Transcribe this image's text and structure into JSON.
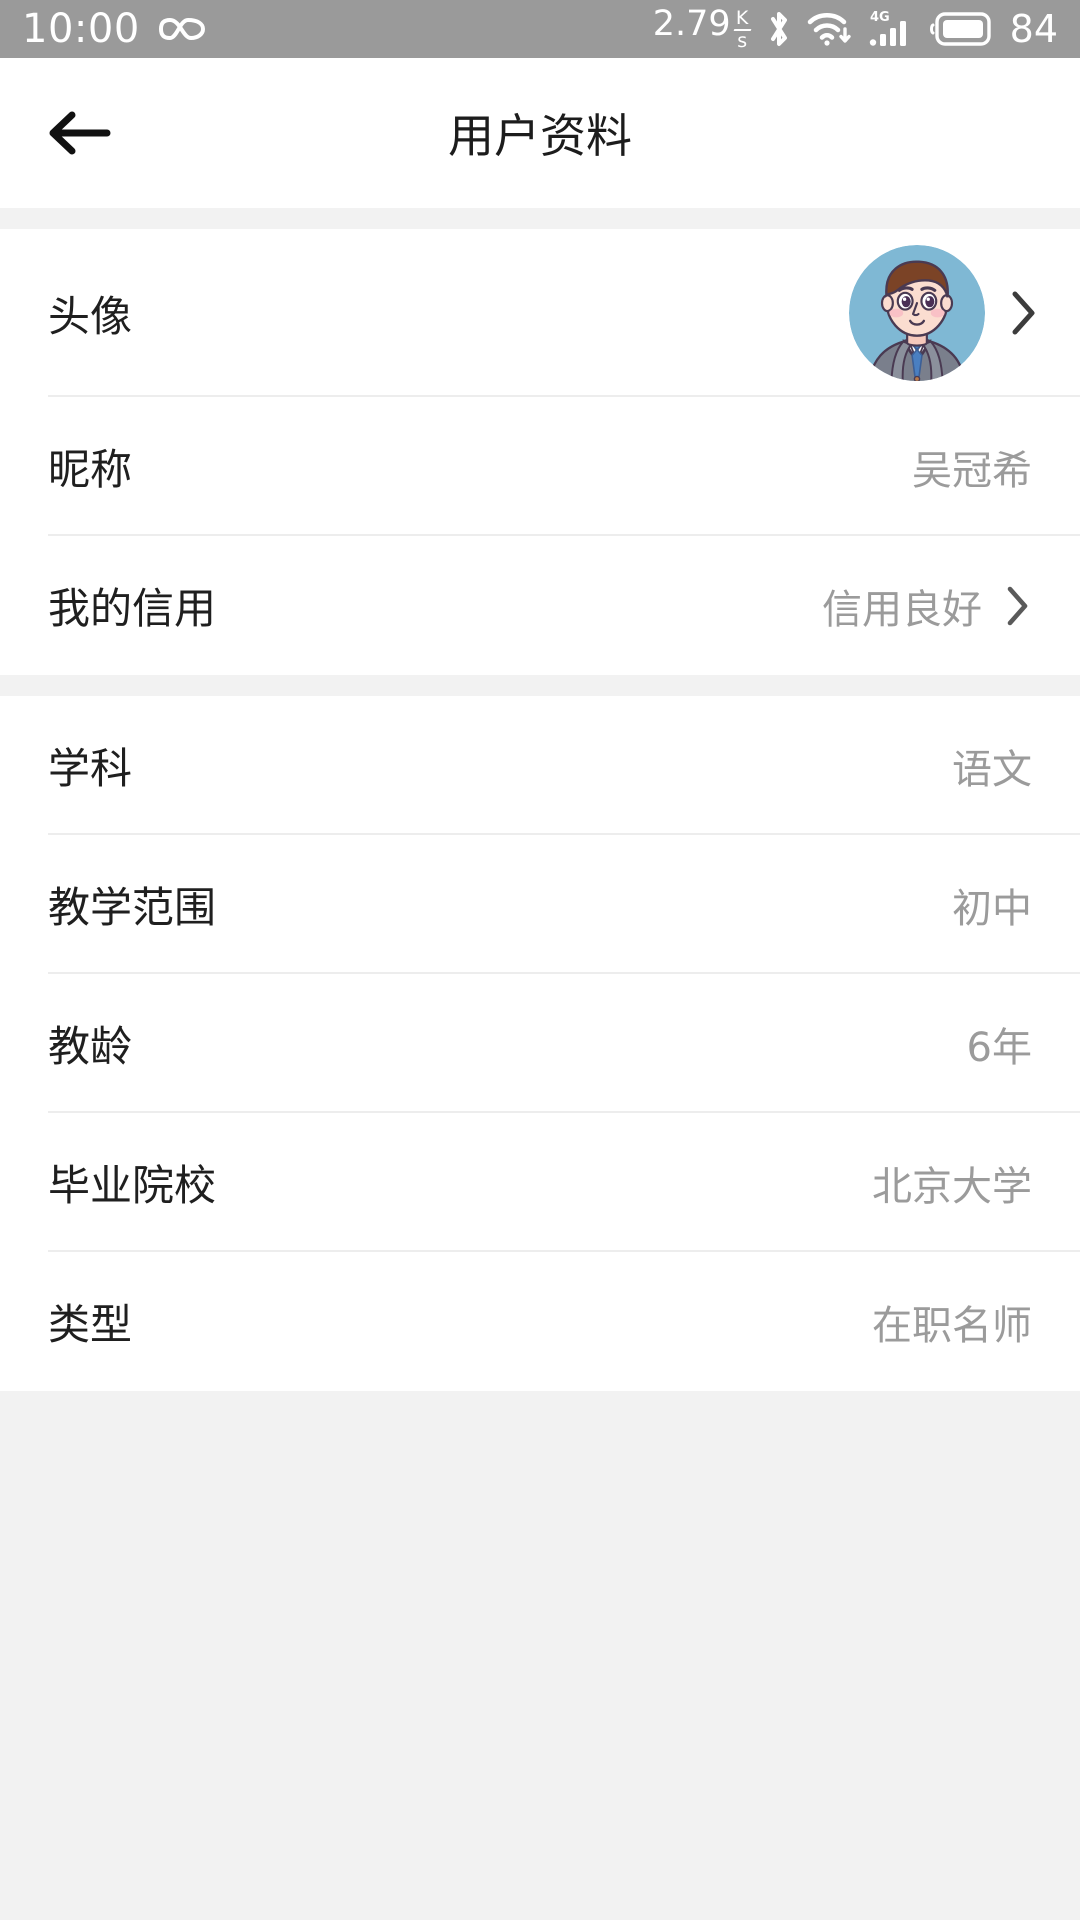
{
  "status_bar": {
    "time": "10:00",
    "infinity_icon": "infinity-icon",
    "network_speed": "2.79",
    "speed_unit_top": "K",
    "speed_unit_bottom": "s",
    "bluetooth_icon": "bluetooth-icon",
    "wifi_icon": "wifi-download-icon",
    "signal_label": "4G",
    "signal_icon": "cellular-signal-icon",
    "battery_icon": "battery-icon",
    "battery_level": "84"
  },
  "header": {
    "title": "用户资料",
    "back_icon": "arrow-left-icon"
  },
  "sections": [
    {
      "rows": [
        {
          "label": "头像",
          "value": "",
          "type": "avatar",
          "chevron": true
        },
        {
          "label": "昵称",
          "value": "吴冠希",
          "type": "text",
          "chevron": false
        },
        {
          "label": "我的信用",
          "value": "信用良好",
          "type": "text",
          "chevron": true
        }
      ]
    },
    {
      "rows": [
        {
          "label": "学科",
          "value": "语文",
          "type": "text",
          "chevron": false
        },
        {
          "label": "教学范围",
          "value": "初中",
          "type": "text",
          "chevron": false
        },
        {
          "label": "教龄",
          "value": "6年",
          "type": "text",
          "chevron": false
        },
        {
          "label": "毕业院校",
          "value": "北京大学",
          "type": "text",
          "chevron": false
        },
        {
          "label": "类型",
          "value": "在职名师",
          "type": "text",
          "chevron": false
        }
      ]
    }
  ],
  "avatar": {
    "name": "user-avatar",
    "background_color": "#7fb8d4",
    "hair_color": "#7b4326",
    "skin_color": "#fbddd0",
    "suit_color": "#7a7f8c",
    "tie_color": "#4a7fc1",
    "shirt_color": "#ffffff"
  },
  "colors": {
    "status_bar_bg": "#9a9a9a",
    "page_bg": "#f2f2f2",
    "card_bg": "#ffffff",
    "label_text": "#1f1f1f",
    "value_text": "#9b9b9b",
    "divider": "#ededed",
    "chevron": "#3c3c3c"
  }
}
